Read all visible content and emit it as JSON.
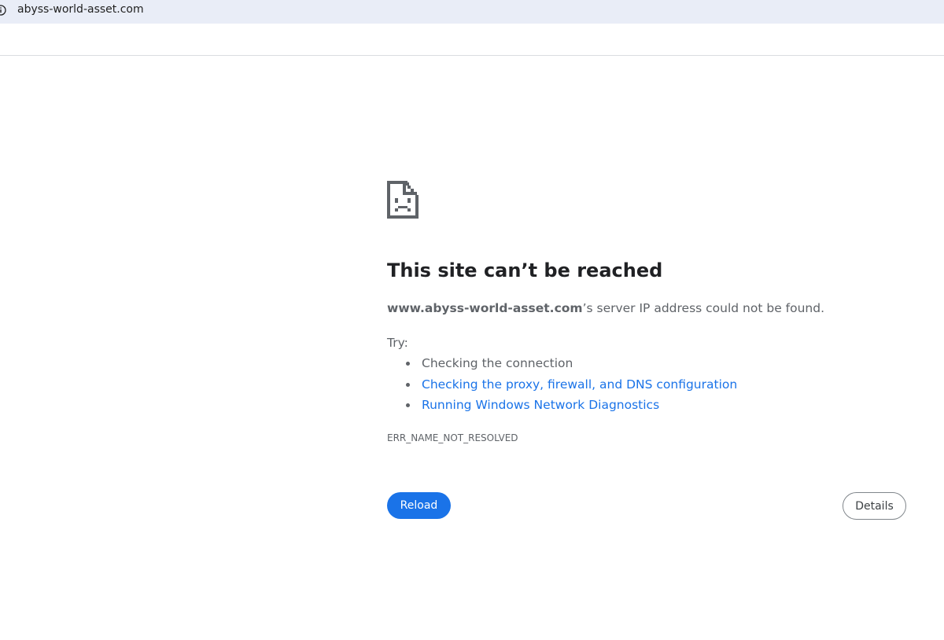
{
  "address_bar": {
    "url": "abyss-world-asset.com",
    "icon": "info-icon"
  },
  "error": {
    "icon": "sad-page-icon",
    "title": "This site can’t be reached",
    "host": "www.abyss-world-asset.com",
    "message": "’s server IP address could not be found.",
    "try_label": "Try:",
    "suggestions": [
      {
        "text": "Checking the connection",
        "link": false
      },
      {
        "text": "Checking the proxy, firewall, and DNS configuration",
        "link": true
      },
      {
        "text": "Running Windows Network Diagnostics",
        "link": true
      }
    ],
    "code": "ERR_NAME_NOT_RESOLVED"
  },
  "buttons": {
    "reload_label": "Reload",
    "details_label": "Details"
  },
  "colors": {
    "accent": "#1a73e8",
    "text": "#5f6368",
    "title": "#202124",
    "address_bar_bg": "#e9edf7"
  }
}
